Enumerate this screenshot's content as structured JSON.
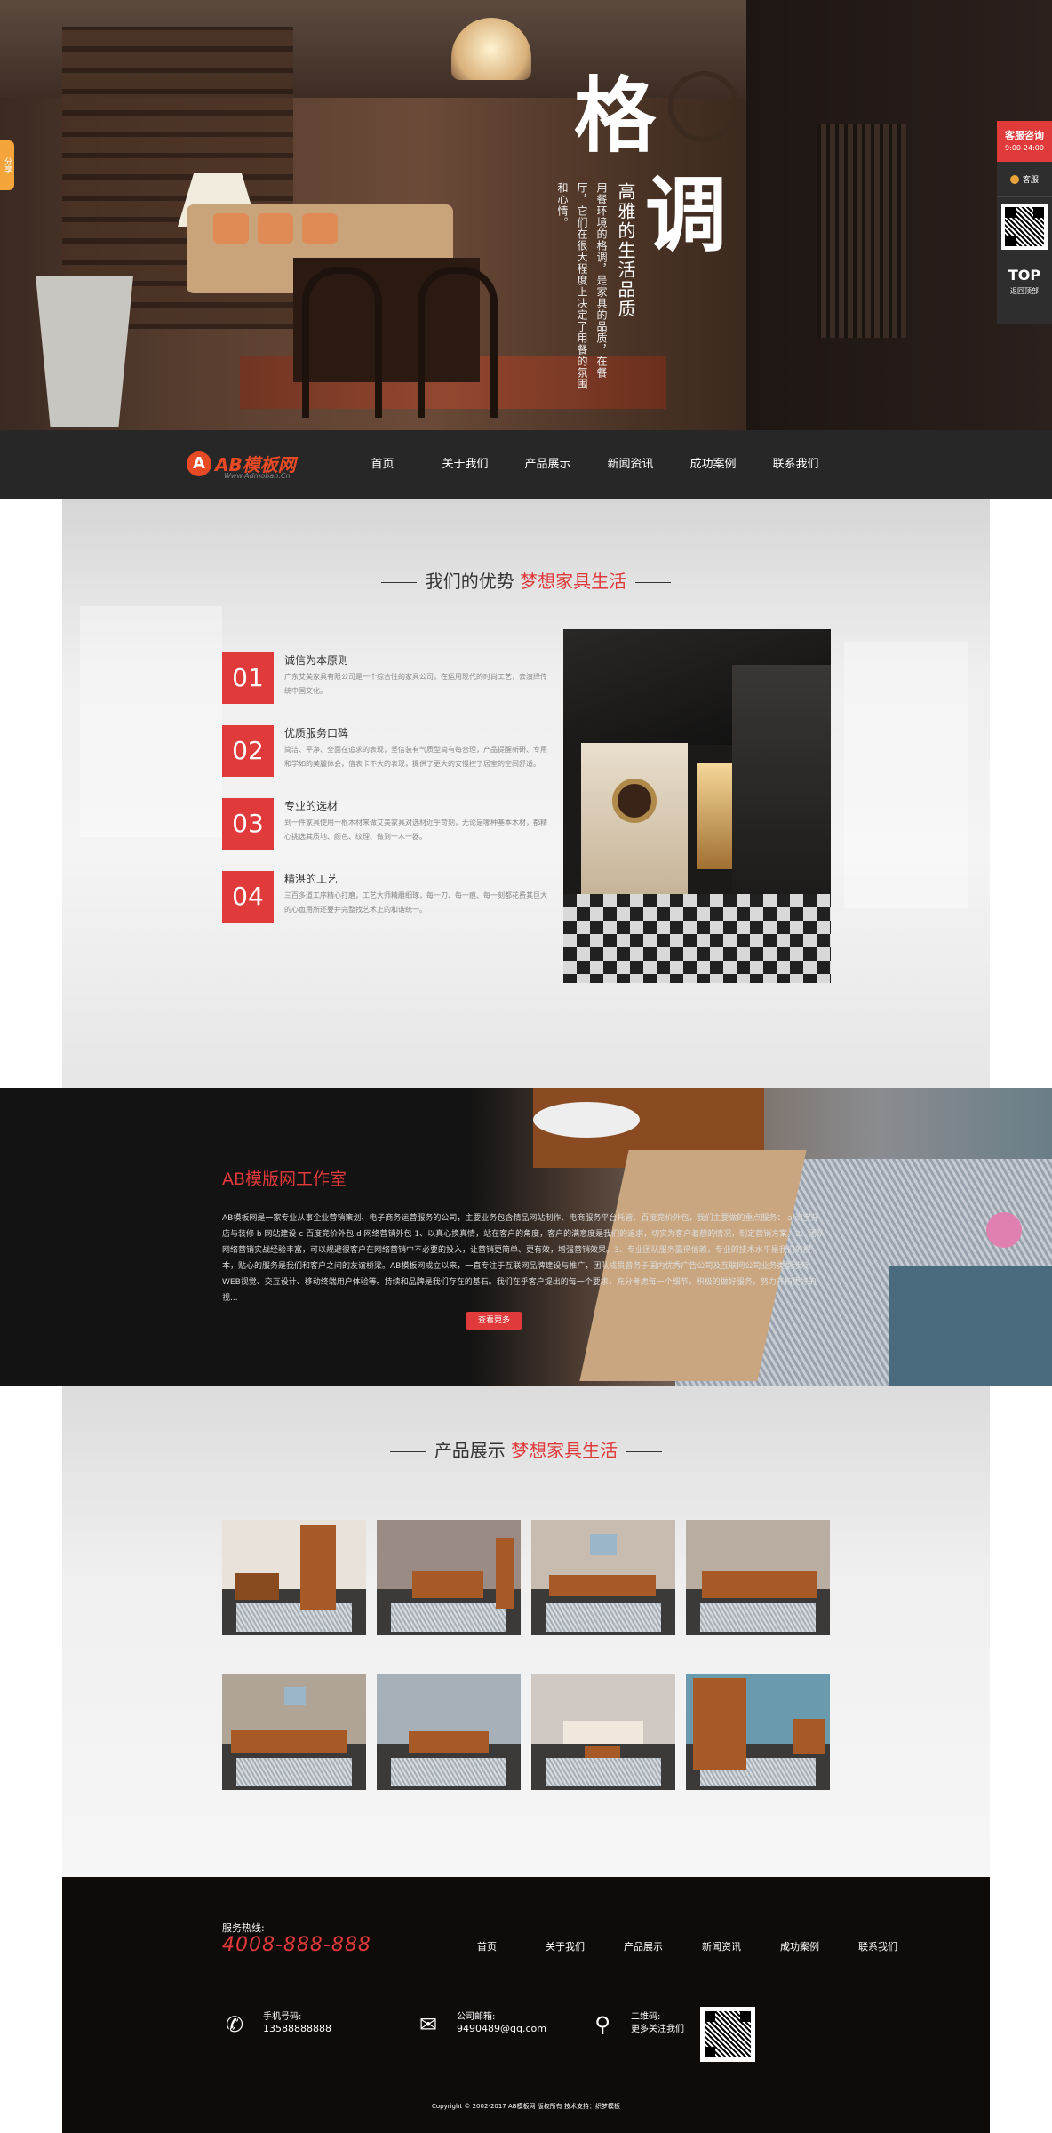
{
  "hero": {
    "big_char_1": "格",
    "big_char_2": "调",
    "subtitle": "高雅的生活品质",
    "body": "用餐环境的格调，是家具的品质，在餐厅，它们在很大程度上决定了用餐的氛围和心情。"
  },
  "side_tag": "分享",
  "float": {
    "service_label": "客服咨询",
    "service_hours": "9:00-24:00",
    "qq_label": "客服",
    "top_label": "TOP",
    "top_sub": "返回顶部"
  },
  "nav": {
    "logo_mark": "A",
    "logo_name": "AB模板网",
    "logo_sub": "Www.Admoban.Cn",
    "items": [
      "首页",
      "关于我们",
      "产品展示",
      "新闻资讯",
      "成功案例",
      "联系我们"
    ]
  },
  "advantage": {
    "title": "我们的优势",
    "title_red": "梦想家具生活",
    "items": [
      {
        "num": "01",
        "title": "诚信为本原则",
        "text": "广东艾美家具有限公司是一个综合性的家具公司，在运用现代的时尚工艺，去演绎传统中国文化。"
      },
      {
        "num": "02",
        "title": "优质服务口碑",
        "text": "简洁、平净、全面在追求的表现，坚信装有气质型简有每合理，产品提醒新研、专用和学如的美麗体会，信表卡不大的表现，提供了更大的安慢控了居室的空间舒适。"
      },
      {
        "num": "03",
        "title": "专业的选材",
        "text": "到一件家具使用一根木材来做艾美家具对选材近乎苛刻，无论是哪种基本木材，都精心挑选其质地、颜色、纹理、做到一木一器。"
      },
      {
        "num": "04",
        "title": "精湛的工艺",
        "text": "三百多道工序精心打磨，工艺大师精雕细琢，每一刀、每一痕、每一刻都花费其巨大的心血用所还要并完整找艺术上的和谐统一。"
      }
    ]
  },
  "studio": {
    "title": "AB模版网工作室",
    "desc": "AB模板网是一家专业从事企业营销策划、电子商务运营服务的公司，主要业务包含精品网站制作、电商服务平台托管、百度竞价外包，我们主要做的重点服务： a 淘宝开店与装修 b 网站建设 c 百度竞价外包 d 网络营销外包 1、以真心换真情，站在客户的角度，客户的满意度是我们的追求，切实为客户着想的情况，制定营销方案。2、团队网络营销实战经验丰富，可以规避很客户在网络营销中不必要的投入，让营销更简单、更有效，增强营销效果。3、专业团队服务赢得信赖，专业的技术水平是我们的根本，贴心的服务是我们和客户之间的友谊桥梁。AB模板网成立以来，一直专注于互联网品牌建设与推广，团队成员曾务于国内优秀广告公司及互联网公司业务类型涉及WEB视觉、交互设计、移动终端用户体验等。持续和品牌是我们存在的基石。我们在乎客户提出的每一个要求，充分考虑每一个细节，积极的做好服务，努力开拓更好的视...",
    "more": "查看更多"
  },
  "products": {
    "title": "产品展示",
    "title_red": "梦想家具生活"
  },
  "footer": {
    "hotline_label": "服务热线:",
    "hotline": "4008-888-888",
    "menu": [
      "首页",
      "关于我们",
      "产品展示",
      "新闻资讯",
      "成功案例",
      "联系我们"
    ],
    "phone_label": "手机号码:",
    "phone": "13588888888",
    "email_label": "公司邮箱:",
    "email": "9490489@qq.com",
    "qr_label": "二维码:",
    "qr_sub": "更多关注我们",
    "copyright": "Copyright © 2002-2017 AB模板网 版权所有 技术支持：织梦模板"
  },
  "colors": {
    "accent": "#e03a3a",
    "nav_bg": "#272727",
    "logo": "#e84a25"
  }
}
